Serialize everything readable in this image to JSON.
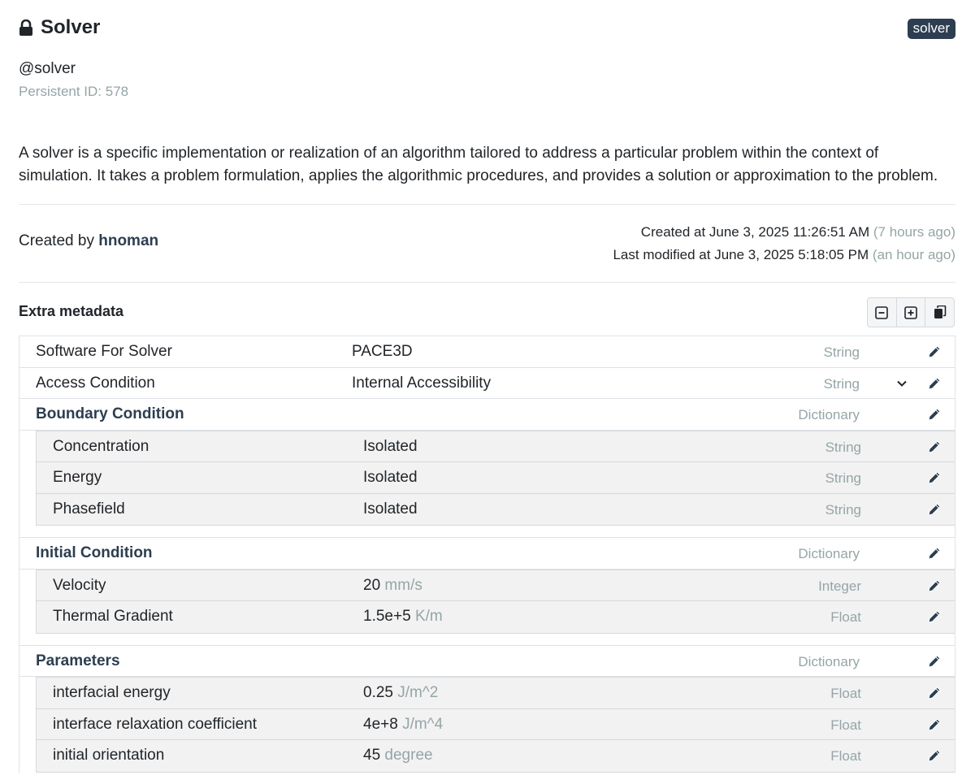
{
  "header": {
    "title": "Solver",
    "badge": "solver"
  },
  "handle": "@solver",
  "persistent_id": "Persistent ID: 578",
  "description": "A solver is a specific implementation or realization of an algorithm tailored to address a particular problem within the context of simulation. It takes a problem formulation, applies the algorithmic procedures, and provides a solution or approximation to the problem.",
  "created_by": {
    "prefix": "Created by",
    "user": "hnoman"
  },
  "timestamps": {
    "created": "Created at June 3, 2025 11:26:51 AM",
    "created_rel": "(7 hours ago)",
    "modified": "Last modified at June 3, 2025 5:18:05 PM",
    "modified_rel": "(an hour ago)"
  },
  "extra": {
    "title": "Extra metadata",
    "rows": {
      "software": {
        "key": "Software For Solver",
        "value": "PACE3D",
        "type": "String"
      },
      "access": {
        "key": "Access Condition",
        "value": "Internal Accessibility",
        "type": "String"
      },
      "boundary": {
        "key": "Boundary Condition",
        "type": "Dictionary",
        "items": [
          {
            "key": "Concentration",
            "value": "Isolated",
            "type": "String"
          },
          {
            "key": "Energy",
            "value": "Isolated",
            "type": "String"
          },
          {
            "key": "Phasefield",
            "value": "Isolated",
            "type": "String"
          }
        ]
      },
      "initial": {
        "key": "Initial Condition",
        "type": "Dictionary",
        "items": [
          {
            "key": "Velocity",
            "value": "20",
            "unit": "mm/s",
            "type": "Integer"
          },
          {
            "key": "Thermal Gradient",
            "value": "1.5e+5",
            "unit": "K/m",
            "type": "Float"
          }
        ]
      },
      "parameters": {
        "key": "Parameters",
        "type": "Dictionary",
        "items": [
          {
            "key": "interfacial energy",
            "value": "0.25",
            "unit": "J/m^2",
            "type": "Float"
          },
          {
            "key": "interface relaxation coefficient",
            "value": "4e+8",
            "unit": "J/m^4",
            "type": "Float"
          },
          {
            "key": "initial orientation",
            "value": "45",
            "unit": "degree",
            "type": "Float"
          }
        ]
      }
    }
  },
  "icons": {
    "lock": "lock-icon",
    "collapse": "collapse-all-icon",
    "expand": "expand-all-icon",
    "copy": "copy-icon",
    "edit": "pencil-icon",
    "chevron": "chevron-down-icon"
  },
  "colors": {
    "accent": "#2c3e50",
    "muted": "#95a5a6",
    "nested_bg": "#f2f2f2"
  }
}
